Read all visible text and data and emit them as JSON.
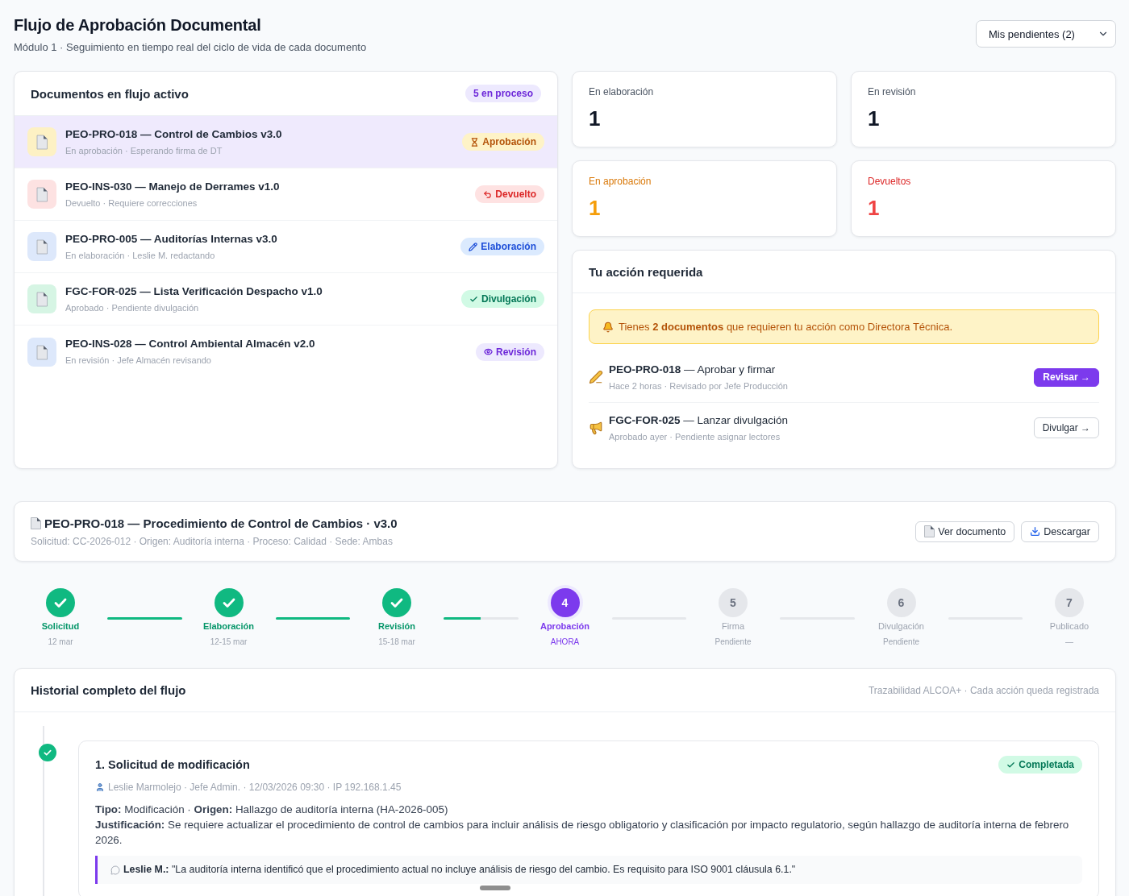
{
  "header": {
    "title": "Flujo de Aprobación Documental",
    "subtitle": "Módulo 1 · Seguimiento en tiempo real del ciclo de vida de cada documento",
    "filter": {
      "value": "Mis pendientes (2)"
    }
  },
  "documents": {
    "title": "Documentos en flujo activo",
    "count_badge": "5 en proceso",
    "items": [
      {
        "title": "PEO-PRO-018 — Control de Cambios v3.0",
        "subtitle": "En aprobación · Esperando firma de DT",
        "color": "#fdf1c4",
        "kind": "approval",
        "status": "Aprobación",
        "selected": true
      },
      {
        "title": "PEO-INS-030 — Manejo de Derrames v1.0",
        "subtitle": "Devuelto · Requiere correcciones",
        "color": "#fde2e2",
        "kind": "returned",
        "status": "Devuelto",
        "selected": false
      },
      {
        "title": "PEO-PRO-005 — Auditorías Internas v3.0",
        "subtitle": "En elaboración · Leslie M. redactando",
        "color": "#dde8fb",
        "kind": "drafting",
        "status": "Elaboración",
        "selected": false
      },
      {
        "title": "FGC-FOR-025 — Lista Verificación Despacho v1.0",
        "subtitle": "Aprobado · Pendiente divulgación",
        "color": "#d6f5e4",
        "kind": "dissemination",
        "status": "Divulgación",
        "selected": false
      },
      {
        "title": "PEO-INS-028 — Control Ambiental Almacén v2.0",
        "subtitle": "En revisión · Jefe Almacén revisando",
        "color": "#dde8fb",
        "kind": "review",
        "status": "Revisión",
        "selected": false
      }
    ]
  },
  "stats": [
    {
      "label": "En elaboración",
      "value": "1",
      "kind": "neutral"
    },
    {
      "label": "En revisión",
      "value": "1",
      "kind": "neutral"
    },
    {
      "label": "En aprobación",
      "value": "1",
      "kind": "warning"
    },
    {
      "label": "Devueltos",
      "value": "1",
      "kind": "danger"
    }
  ],
  "actions": {
    "title": "Tu acción requerida",
    "alert": "Tienes **2 documentos** que requieren tu acción como Directora Técnica.",
    "items": [
      {
        "kind": "sign",
        "title": "**PEO-PRO-018** — Aprobar y firmar",
        "subtitle": "Hace 2 horas · Revisado por Jefe Producción",
        "button": {
          "label": "Revisar →",
          "kind": "primary"
        }
      },
      {
        "kind": "announce",
        "title": "**FGC-FOR-025** — Lanzar divulgación",
        "subtitle": "Aprobado ayer · Pendiente asignar lectores",
        "button": {
          "label": "Divulgar →",
          "kind": "secondary"
        }
      }
    ]
  },
  "document_detail": {
    "title": "PEO-PRO-018 — Procedimiento de Control de Cambios · v3.0",
    "meta": "Solicitud: CC-2026-012 · Origen: Auditoría interna · Proceso: Calidad · Sede: Ambas",
    "buttons": [
      {
        "kind": "view",
        "label": "Ver documento"
      },
      {
        "kind": "download",
        "label": "Descargar"
      }
    ]
  },
  "stepper": {
    "steps": [
      {
        "kind": "done",
        "label": "Solicitud",
        "date": "12 mar"
      },
      {
        "kind": "done",
        "label": "Elaboración",
        "date": "12-15 mar"
      },
      {
        "kind": "done",
        "label": "Revisión",
        "date": "15-18 mar"
      },
      {
        "kind": "current",
        "number": "4",
        "label": "Aprobación",
        "date": "AHORA"
      },
      {
        "kind": "pending",
        "number": "5",
        "label": "Firma",
        "date": "Pendiente"
      },
      {
        "kind": "pending",
        "number": "6",
        "label": "Divulgación",
        "date": "Pendiente"
      },
      {
        "kind": "pending",
        "number": "7",
        "label": "Publicado",
        "date": "—"
      }
    ],
    "connectors": [
      {
        "level": 1
      },
      {
        "level": 1
      },
      {
        "level": 0.5
      },
      {
        "level": 0
      },
      {
        "level": 0
      },
      {
        "level": 0
      }
    ]
  },
  "history": {
    "title": "Historial completo del flujo",
    "note": "Trazabilidad ALCOA+ · Cada acción queda registrada",
    "entries": [
      {
        "kind": "completed",
        "title": "1. Solicitud de modificación",
        "badge": "Completada",
        "meta": "Leslie Marmolejo · Jefe Admin. · 12/03/2026 09:30 · IP 192.168.1.45",
        "details": [
          "**Tipo:** Modificación · **Origen:** Hallazgo de auditoría interna (HA-2026-005)",
          "**Justificación:** Se requiere actualizar el procedimiento de control de cambios para incluir análisis de riesgo obligatorio y clasificación por impacto regulatorio, según hallazgo de auditoría interna de febrero 2026."
        ],
        "comment": "**Leslie M.:** \"La auditoría interna identificó que el procedimiento actual no incluye análisis de riesgo del cambio. Es requisito para ISO 9001 cláusula 6.1.\""
      }
    ]
  }
}
